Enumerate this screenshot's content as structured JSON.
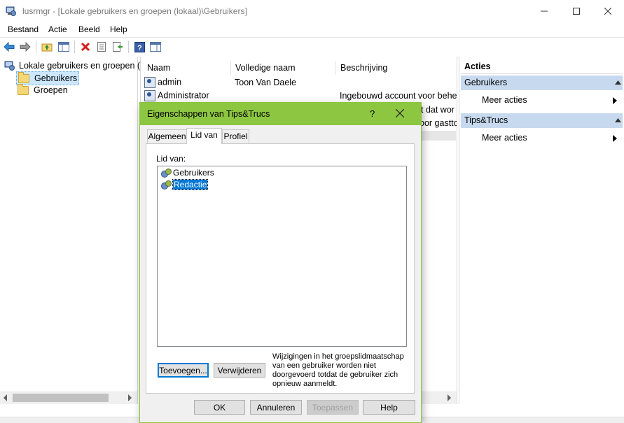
{
  "window": {
    "title": "lusrmgr - [Lokale gebruikers en groepen (lokaal)\\Gebruikers]",
    "app_icon": "computer-management-icon"
  },
  "menu": [
    "Bestand",
    "Actie",
    "Beeld",
    "Help"
  ],
  "toolbar": {
    "icons": [
      "back-arrow-icon",
      "forward-arrow-icon",
      "up-folder-icon",
      "show-hide-tree-icon",
      "delete-icon",
      "properties-icon",
      "export-list-icon",
      "help-icon",
      "action-pane-icon"
    ]
  },
  "tree": {
    "root": "Lokale gebruikers en groepen (lokaal)",
    "items": [
      "Gebruikers",
      "Groepen"
    ],
    "selected": "Gebruikers"
  },
  "list": {
    "columns": [
      "Naam",
      "Volledige naam",
      "Beschrijving"
    ],
    "rows": [
      {
        "name": "admin",
        "fullname": "Toon Van Daele",
        "description": ""
      },
      {
        "name": "Administrator",
        "fullname": "",
        "description": "Ingebouwd account voor behe"
      },
      {
        "name": "",
        "fullname": "",
        "description": "t dat wor"
      },
      {
        "name": "",
        "fullname": "",
        "description": "oor gastto"
      }
    ]
  },
  "actions": {
    "header": "Acties",
    "sections": [
      {
        "title": "Gebruikers",
        "item": "Meer acties"
      },
      {
        "title": "Tips&Trucs",
        "item": "Meer acties"
      }
    ]
  },
  "dialog": {
    "title": "Eigenschappen van Tips&Trucs",
    "help_glyph": "?",
    "tabs": [
      "Algemeen",
      "Lid van",
      "Profiel"
    ],
    "active_tab": "Lid van",
    "member_label": "Lid van:",
    "members": [
      "Gebruikers",
      "Redactie"
    ],
    "selected_member": "Redactie",
    "add_button": "Toevoegen...",
    "remove_button": "Verwijderen",
    "note": "Wijzigingen in het groepslidmaatschap van een gebruiker worden niet doorgevoerd totdat de gebruiker zich opnieuw aanmeldt.",
    "ok_button": "OK",
    "cancel_button": "Annuleren",
    "apply_button": "Toepassen",
    "help_button": "Help"
  },
  "colors": {
    "dialog_titlebar": "#8dc741",
    "selection": "#0078d7",
    "actions_header": "#c7d9ee"
  }
}
